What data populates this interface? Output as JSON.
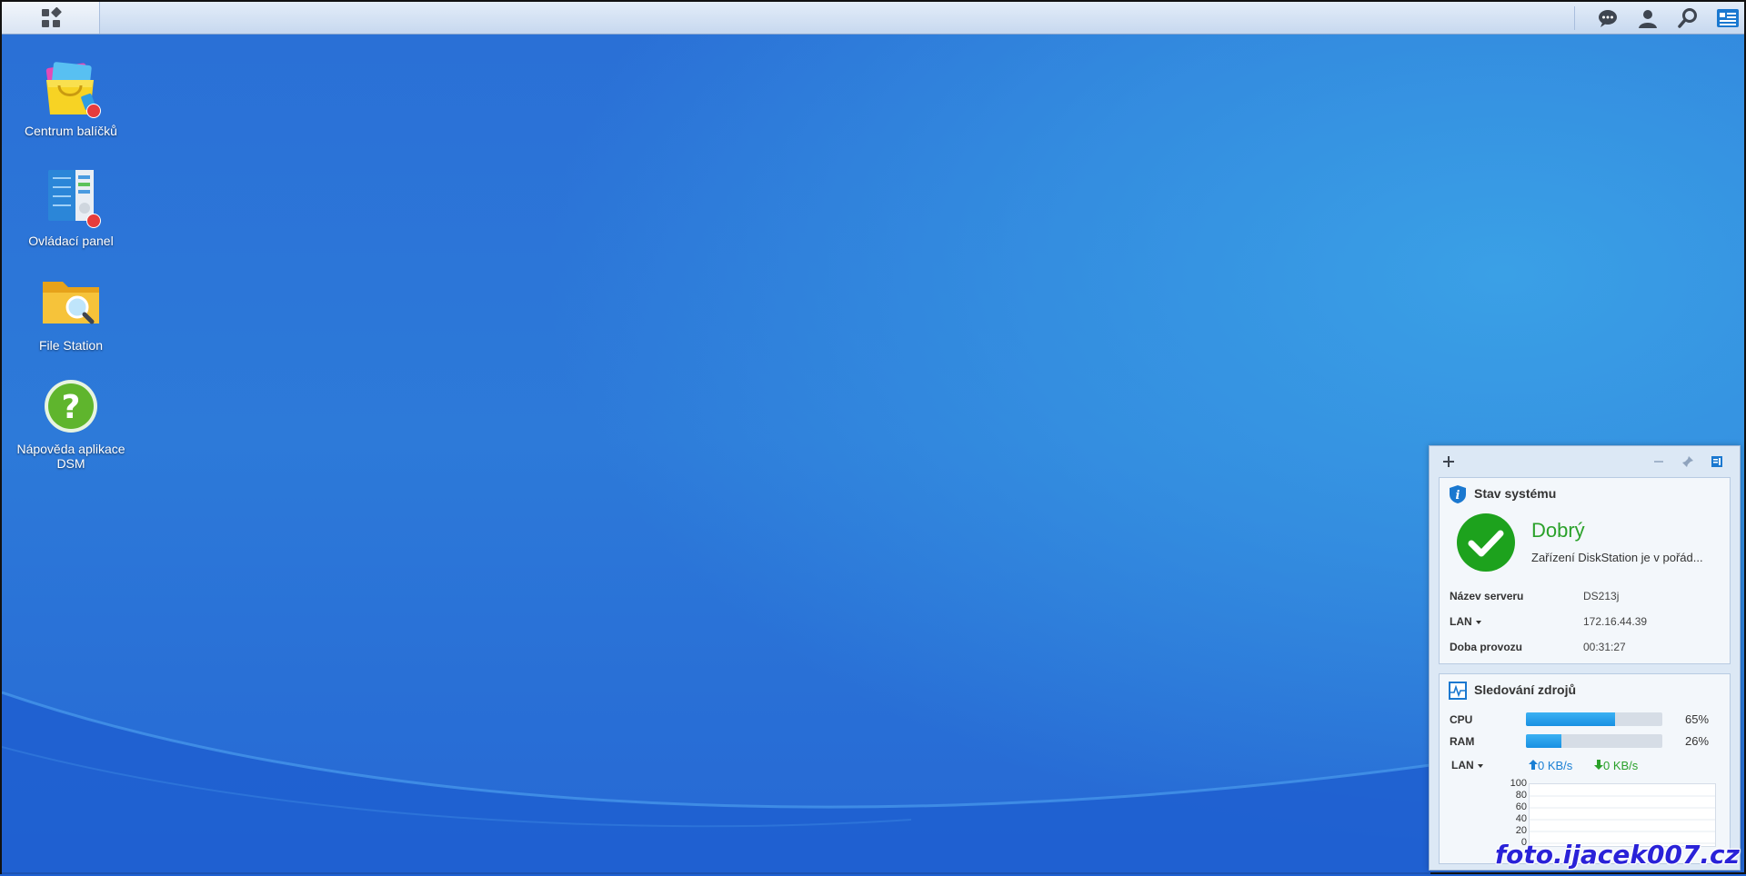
{
  "taskbar": {
    "main_menu_icon": "grid-icon",
    "right_icons": [
      "chat-icon",
      "user-icon",
      "search-icon",
      "widgets-icon"
    ]
  },
  "desktop": {
    "icons": [
      {
        "label": "Centrum balíčků",
        "icon": "package-center-icon",
        "has_badge": true
      },
      {
        "label": "Ovládací panel",
        "icon": "control-panel-icon",
        "has_badge": true
      },
      {
        "label": "File Station",
        "icon": "file-station-icon",
        "has_badge": false
      },
      {
        "label": "Nápověda aplikace DSM",
        "icon": "help-icon",
        "has_badge": false
      }
    ]
  },
  "widgets": {
    "system_status": {
      "title": "Stav systému",
      "status": "Dobrý",
      "description": "Zařízení DiskStation je v pořád...",
      "rows": [
        {
          "label": "Název serveru",
          "value": "DS213j"
        },
        {
          "label": "LAN",
          "value": "172.16.44.39"
        },
        {
          "label": "Doba provozu",
          "value": "00:31:27"
        }
      ]
    },
    "resource_monitor": {
      "title": "Sledování zdrojů",
      "cpu_label": "CPU",
      "cpu_percent": 65,
      "cpu_text": "65%",
      "ram_label": "RAM",
      "ram_percent": 26,
      "ram_text": "26%",
      "lan_label": "LAN",
      "upload": "0 KB/s",
      "download": "0 KB/s",
      "chart_yticks": [
        "100",
        "80",
        "60",
        "40",
        "20",
        "0"
      ]
    }
  },
  "colors": {
    "status_good": "#2aa12a",
    "bar_fill": "#1890e2",
    "upload_color": "#1a7fd4",
    "download_color": "#2aa12a"
  },
  "watermark": "foto.ijacek007.cz :-)"
}
